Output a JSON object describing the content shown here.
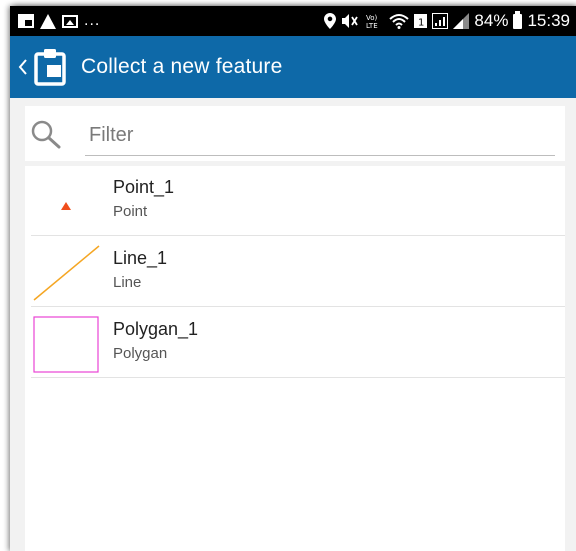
{
  "statusbar": {
    "left_dots": "...",
    "battery_percent": "84%",
    "time": "15:39",
    "icons_left": [
      "notification-square-icon",
      "warning-icon",
      "image-icon"
    ],
    "icons_right": [
      "location-icon",
      "mute-icon",
      "volte-icon",
      "wifi-icon",
      "sim-icon",
      "signal-icon",
      "battery-icon"
    ]
  },
  "appbar": {
    "title": "Collect a new feature",
    "background": "#0e69a8"
  },
  "filter": {
    "placeholder": "Filter",
    "value": ""
  },
  "features": [
    {
      "name": "Point_1",
      "type": "Point",
      "icon": "point-triangle-icon",
      "color": "#f04e1b"
    },
    {
      "name": "Line_1",
      "type": "Line",
      "icon": "line-icon",
      "color": "#f5a623"
    },
    {
      "name": "Polygan_1",
      "type": "Polygan",
      "icon": "polygon-icon",
      "color": "#ea44d4"
    }
  ]
}
